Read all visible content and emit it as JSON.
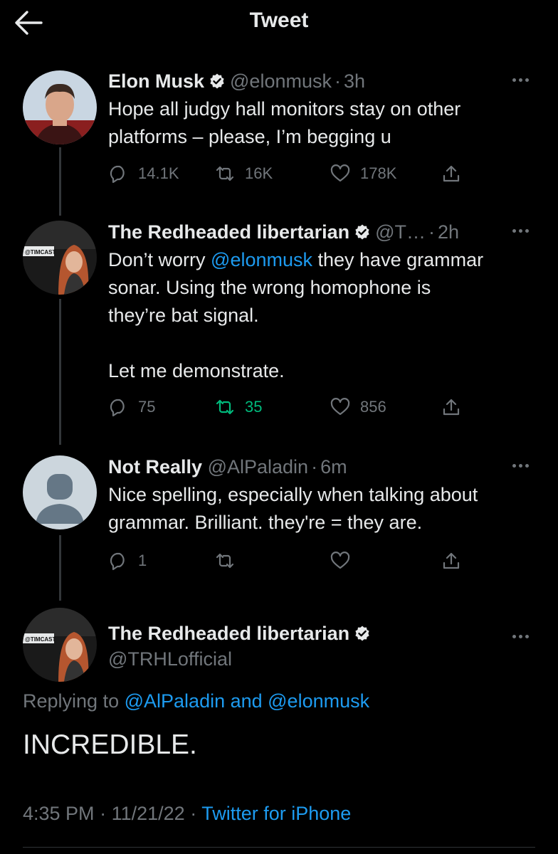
{
  "header": {
    "title": "Tweet",
    "back_icon": "arrow-left-icon"
  },
  "colors": {
    "background": "#000000",
    "text": "#e7e9ea",
    "muted": "#71767b",
    "link": "#1d9bf0",
    "retweeted": "#00ba7c",
    "verified": "#e7e9ea"
  },
  "tweets": [
    {
      "name": "Elon Musk",
      "handle": "@elonmusk",
      "sep": "·",
      "time": "3h",
      "text_lines": [
        "Hope all judgy hall monitors stay on other",
        "platforms – please, I’m begging u"
      ],
      "replies": "14.1K",
      "retweets": "16K",
      "likes": "178K"
    },
    {
      "name": "The Redheaded libertarian",
      "handle": "@T…",
      "sep": "·",
      "time": "2h",
      "text_pre": "Don’t worry ",
      "mention": "@elonmusk",
      "text_post": " they have grammar",
      "text_lines": [
        "sonar. Using the wrong homophone is",
        "they’re bat signal."
      ],
      "text_last": "Let me demonstrate.",
      "avatar_tag": "@TIMCAST",
      "replies": "75",
      "retweets": "35",
      "likes": "856"
    },
    {
      "name": "Not Really",
      "handle": "@AlPaladin",
      "sep": "·",
      "time": "6m",
      "text_lines": [
        "Nice spelling, especially when talking about",
        "grammar. Brilliant.  they're = they are."
      ],
      "replies": "1",
      "retweets": "",
      "likes": ""
    }
  ],
  "detail": {
    "name": "The Redheaded libertarian",
    "handle": "@TRHLofficial",
    "avatar_tag": "@TIMCAST",
    "replying_prefix": "Replying to",
    "replying_users": "@AlPaladin and @elonmusk",
    "text": "INCREDIBLE.",
    "time": "4:35 PM",
    "date": "11/21/22",
    "sep": "·",
    "source": "Twitter for iPhone"
  }
}
